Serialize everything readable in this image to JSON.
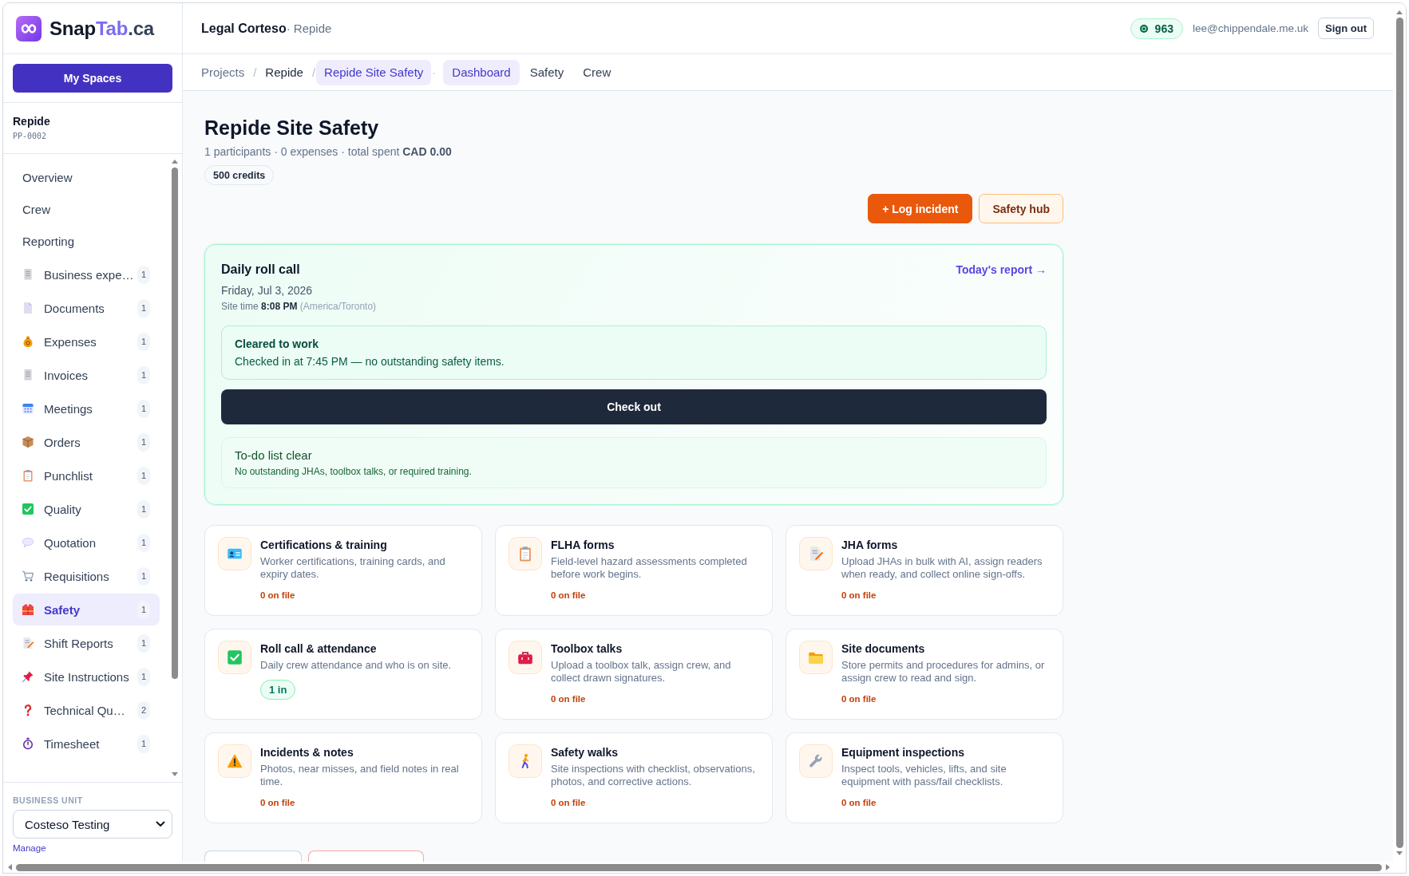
{
  "sidebar": {
    "brand": {
      "name": "Snap",
      "accent": "Tab",
      "suffix": ".ca"
    },
    "spaces_button": "My Spaces",
    "project": {
      "name": "Repide",
      "code": "PP-0002"
    },
    "nav": [
      {
        "kind": "link",
        "label": "Overview",
        "selected": false
      },
      {
        "kind": "link",
        "label": "Crew",
        "selected": false
      },
      {
        "kind": "link",
        "label": "Reporting",
        "selected": false
      },
      {
        "kind": "module",
        "label": "Business expe…",
        "count": "1",
        "selected": false
      },
      {
        "kind": "module",
        "label": "Documents",
        "count": "1",
        "selected": false
      },
      {
        "kind": "module",
        "label": "Expenses",
        "count": "1",
        "selected": false
      },
      {
        "kind": "module",
        "label": "Invoices",
        "count": "1",
        "selected": false
      },
      {
        "kind": "module",
        "label": "Meetings",
        "count": "1",
        "selected": false
      },
      {
        "kind": "module",
        "label": "Orders",
        "count": "1",
        "selected": false
      },
      {
        "kind": "module",
        "label": "Punchlist",
        "count": "1",
        "selected": false
      },
      {
        "kind": "module",
        "label": "Quality",
        "count": "1",
        "selected": false
      },
      {
        "kind": "module",
        "label": "Quotation",
        "count": "1",
        "selected": false
      },
      {
        "kind": "module",
        "label": "Requisitions",
        "count": "1",
        "selected": false
      },
      {
        "kind": "module",
        "label": "Safety",
        "count": "1",
        "selected": true
      },
      {
        "kind": "module",
        "label": "Shift Reports",
        "count": "1",
        "selected": false
      },
      {
        "kind": "module",
        "label": "Site Instructions",
        "count": "1",
        "selected": false
      },
      {
        "kind": "module",
        "label": "Technical Qu…",
        "count": "2",
        "selected": false
      },
      {
        "kind": "module",
        "label": "Timesheet",
        "count": "1",
        "selected": false
      }
    ],
    "business_unit": {
      "label": "BUSINESS UNIT",
      "value": "Costeso Testing",
      "link": "Manage"
    }
  },
  "header": {
    "org": "Legal Corteso",
    "project": "· Repide",
    "credits": "963",
    "email": "lee@chippendale.me.uk",
    "sign_out": "Sign out"
  },
  "breadcrumb": [
    {
      "label": "Projects",
      "muted": true,
      "selected": false,
      "separator": "/"
    },
    {
      "label": "Repide",
      "muted": false,
      "selected": false,
      "separator": "/"
    },
    {
      "label": "Repide Site Safety",
      "muted": false,
      "selected": true,
      "separator": "·"
    }
  ],
  "tabs": [
    {
      "label": "Dashboard",
      "selected": true
    },
    {
      "label": "Safety",
      "selected": false
    },
    {
      "label": "Crew",
      "selected": false
    }
  ],
  "page": {
    "title": "Repide Site Safety",
    "summary": "1 participants · 0 expenses · total spent **CAD 0.00**",
    "badge": "500 credits",
    "actions": [
      {
        "kind": "primary",
        "label": "+ Log incident"
      },
      {
        "kind": "secondary",
        "label": "Safety hub"
      }
    ]
  },
  "roll_call": {
    "title": "Daily roll call",
    "report_link": "Today's report →",
    "date": "Friday, Jul 3, 2026",
    "site_time": {
      "label": "Site time",
      "time": "8:08 PM",
      "zone": "(America/Toronto)"
    },
    "status": {
      "title": "Cleared to work",
      "message": "Checked in at 7:45 PM — no outstanding safety items."
    },
    "action": "Check out",
    "todo": {
      "title": "To-do list clear",
      "message": "No outstanding JHAs, toolbox talks, or required training."
    }
  },
  "modules": [
    {
      "title": "Certifications & training",
      "description": "Worker certifications, training cards, and expiry dates.",
      "status": {
        "kind": "count",
        "text": "0 on file"
      }
    },
    {
      "title": "FLHA forms",
      "description": "Field-level hazard assessments completed before work begins.",
      "status": {
        "kind": "count",
        "text": "0 on file"
      }
    },
    {
      "title": "JHA forms",
      "description": "Upload JHAs in bulk with AI, assign readers when ready, and collect online sign-offs.",
      "status": {
        "kind": "count",
        "text": "0 on file"
      }
    },
    {
      "title": "Roll call & attendance",
      "description": "Daily crew attendance and who is on site.",
      "status": {
        "kind": "pill",
        "text": "1 in"
      }
    },
    {
      "title": "Toolbox talks",
      "description": "Upload a toolbox talk, assign crew, and collect drawn signatures.",
      "status": {
        "kind": "count",
        "text": "0 on file"
      }
    },
    {
      "title": "Site documents",
      "description": "Store permits and procedures for admins, or assign crew to read and sign.",
      "status": {
        "kind": "count",
        "text": "0 on file"
      }
    },
    {
      "title": "Incidents & notes",
      "description": "Photos, near misses, and field notes in real time.",
      "status": {
        "kind": "count",
        "text": "0 on file"
      }
    },
    {
      "title": "Safety walks",
      "description": "Site inspections with checklist, observations, photos, and corrective actions.",
      "status": {
        "kind": "count",
        "text": "0 on file"
      }
    },
    {
      "title": "Equipment inspections",
      "description": "Inspect tools, vehicles, lifts, and site equipment with pass/fail checklists.",
      "status": {
        "kind": "count",
        "text": "0 on file"
      }
    }
  ],
  "more_actions": [
    {
      "kind": "outline"
    },
    {
      "kind": "danger"
    }
  ]
}
